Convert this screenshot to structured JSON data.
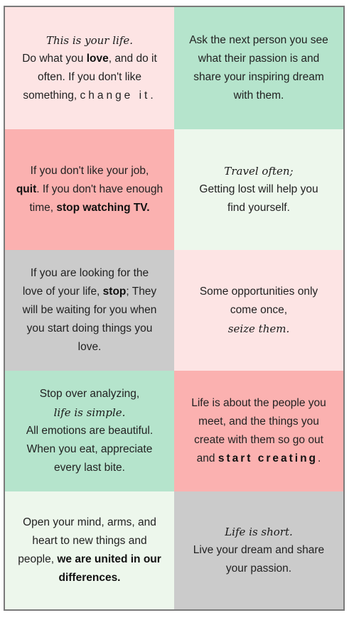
{
  "colors": {
    "pink": "#fde4e4",
    "mint": "#b5e4cc",
    "salmon": "#fbb1b0",
    "pale_green": "#edf7ec",
    "gray": "#cbcbcb",
    "border": "#7a7a7a",
    "text": "#222222"
  },
  "cells": [
    {
      "script": "This is your life.",
      "l1a": "Do what you ",
      "l1b": "love",
      "l1c": ", and do it",
      "l2": "often. If you don't like",
      "l3a": "something, ",
      "l3b": "change it."
    },
    {
      "l1": "Ask the next person you see",
      "l2": "what their passion is and",
      "l3": "share your inspiring dream",
      "l4": "with them."
    },
    {
      "l1": "If you don't like your job,",
      "l2a": "quit",
      "l2b": ". If you don't have enough",
      "l3a": "time, ",
      "l3b": "stop watching TV."
    },
    {
      "script": "Travel often;",
      "l1": "Getting lost will help you",
      "l2": "find yourself."
    },
    {
      "l1": "If you are looking for the",
      "l2a": "love of your life, ",
      "l2b": "stop",
      "l2c": "; They",
      "l3": "will be waiting for you when",
      "l4": "you start doing things you",
      "l5": "love."
    },
    {
      "l1": "Some opportunities only",
      "l2": "come once,",
      "script": "seize them."
    },
    {
      "l1": "Stop over analyzing,",
      "script": "life is simple.",
      "l2": "All emotions are beautiful.",
      "l3": "When you eat, appreciate",
      "l4": "every last bite."
    },
    {
      "l1": "Life is about the people you",
      "l2": "meet, and the things you",
      "l3": "create with them so go out",
      "l4a": "and ",
      "l4b": "start creating",
      "l4c": "."
    },
    {
      "l1": "Open your mind, arms, and",
      "l2": "heart to new things and",
      "l3a": "people, ",
      "l3b": "we are united in our",
      "l4": "differences."
    },
    {
      "script": "Life is short.",
      "l1": "Live your dream and share",
      "l2": "your passion."
    }
  ]
}
